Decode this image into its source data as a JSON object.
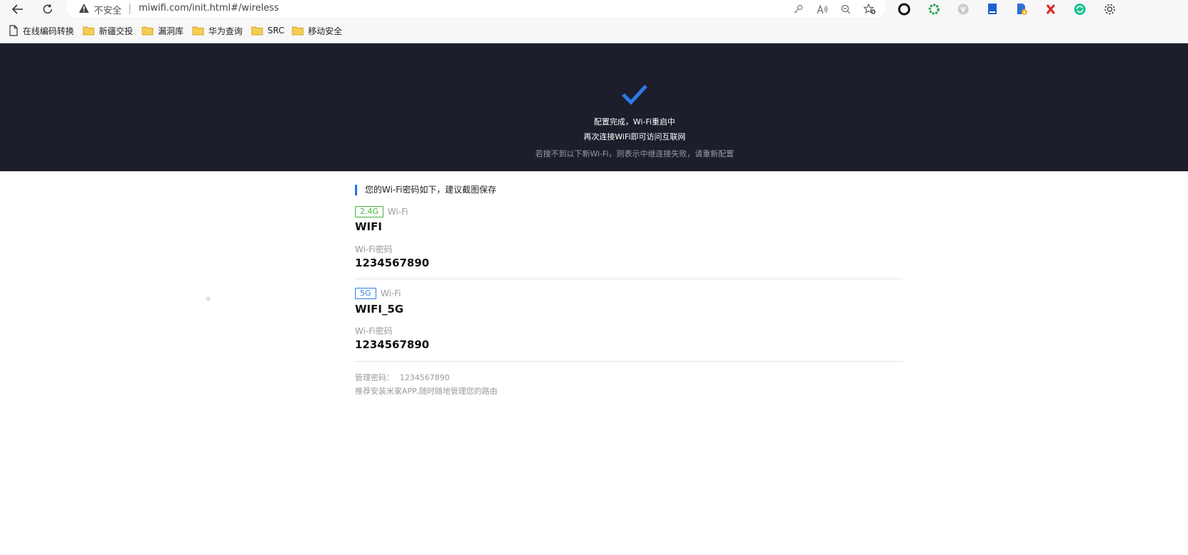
{
  "browser": {
    "security_label": "不安全",
    "url": "miwifi.com/init.html#/wireless",
    "bookmarks": [
      {
        "label": "在线编码转换",
        "icon": "page-icon"
      },
      {
        "label": "新疆交投",
        "icon": "folder-icon"
      },
      {
        "label": "漏洞库",
        "icon": "folder-icon"
      },
      {
        "label": "华为查询",
        "icon": "folder-icon"
      },
      {
        "label": "SRC",
        "icon": "folder-icon"
      },
      {
        "label": "移动安全",
        "icon": "folder-icon"
      }
    ]
  },
  "hero": {
    "status_line1": "配置完成，Wi-Fi重启中",
    "status_line2": "再次连接WiFi即可访问互联网",
    "status_line3": "若搜不到以下新Wi-Fi，则表示中继连接失败，请重新配置"
  },
  "wifi": {
    "notice": "您的Wi-Fi密码如下，建议截图保存",
    "networks": [
      {
        "band": "2.4G",
        "band_suffix": "Wi-Fi",
        "ssid": "WIFI",
        "password_label": "Wi-Fi密码",
        "password": "1234567890"
      },
      {
        "band": "5G",
        "band_suffix": "Wi-Fi",
        "ssid": "WIFI_5G",
        "password_label": "Wi-Fi密码",
        "password": "1234567890"
      }
    ],
    "admin_label": "管理密码：",
    "admin_password": "1234567890",
    "app_tip": "推荐安装米家APP,随时随地管理您的路由"
  },
  "colors": {
    "hero_bg": "#1c1e2b",
    "accent_blue": "#1f75e5",
    "band_24g": "#45b33a",
    "band_5g": "#2d7ee6"
  }
}
